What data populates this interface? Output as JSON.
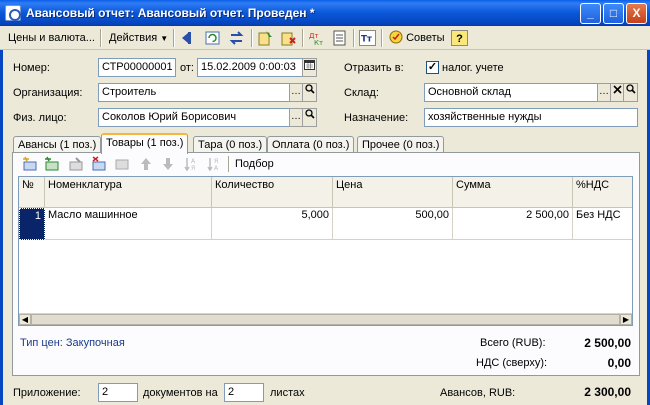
{
  "window": {
    "title": "Авансовый отчет: Авансовый отчет. Проведен *",
    "minimize": "_",
    "maximize": "□",
    "close": "X"
  },
  "toolbar": {
    "prices_label": "Цены и валюта...",
    "actions_label": "Действия",
    "advice_label": "Советы",
    "help_label": "?"
  },
  "form": {
    "number_label": "Номер:",
    "number_value": "СТР00000001",
    "from_label": "от:",
    "date_value": "15.02.2009  0:00:03",
    "reflect_label": "Отразить в:",
    "tax_label": "налог. учете",
    "tax_checked": "✓",
    "org_label": "Организация:",
    "org_value": "Строитель",
    "warehouse_label": "Склад:",
    "warehouse_value": "Основной склад",
    "person_label": "Физ. лицо:",
    "person_value": "Соколов Юрий Борисович",
    "purpose_label": "Назначение:",
    "purpose_value": "хозяйственные нужды"
  },
  "tabs": [
    {
      "label": "Авансы (1 поз.)"
    },
    {
      "label": "Товары (1 поз.)"
    },
    {
      "label": "Тара (0 поз.)"
    },
    {
      "label": "Оплата (0 поз.)"
    },
    {
      "label": "Прочее (0 поз.)"
    }
  ],
  "inner_toolbar": {
    "pick_label": "Подбор"
  },
  "table": {
    "columns": [
      "№",
      "Номенклатура",
      "Количество",
      "Цена",
      "Сумма",
      "%НДС"
    ],
    "rows": [
      {
        "n": "1",
        "item": "Масло машинное",
        "qty": "5,000",
        "price": "500,00",
        "sum": "2 500,00",
        "vat": "Без НДС"
      }
    ]
  },
  "summary": {
    "price_type": "Тип цен: Закупочная",
    "total_label": "Всего (RUB):",
    "total_value": "2 500,00",
    "vat_label": "НДС (сверху):",
    "vat_value": "0,00"
  },
  "bottom": {
    "attach_label": "Приложение:",
    "attach_docs": "2",
    "docs_on_label": "документов на",
    "attach_sheets": "2",
    "sheets_label": "листах",
    "advances_label": "Авансов, RUB:",
    "advances_value": "2 300,00"
  }
}
